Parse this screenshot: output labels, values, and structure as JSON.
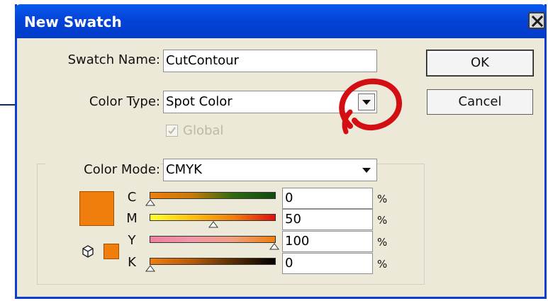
{
  "window": {
    "title": "New Swatch"
  },
  "swatch_name": {
    "label": "Swatch Name:",
    "value": "CutContour"
  },
  "color_type": {
    "label": "Color Type:",
    "value": "Spot Color"
  },
  "global": {
    "label": "Global",
    "checked": true,
    "enabled": false
  },
  "color_mode": {
    "label": "Color Mode:",
    "value": "CMYK"
  },
  "buttons": {
    "ok": "OK",
    "cancel": "Cancel"
  },
  "channels": [
    {
      "label": "C",
      "value": "0",
      "percent": 0,
      "unit": "%"
    },
    {
      "label": "M",
      "value": "50",
      "percent": 50,
      "unit": "%"
    },
    {
      "label": "Y",
      "value": "100",
      "percent": 100,
      "unit": "%"
    },
    {
      "label": "K",
      "value": "0",
      "percent": 0,
      "unit": "%"
    }
  ],
  "colors": {
    "swatch": "#f07e0d",
    "title_bar": "#0443d8",
    "dialog_bg": "#ece9d8",
    "highlight_circle": "#d40f14",
    "callout_line": "#0b2a6b"
  },
  "icons": {
    "close": "close-x-icon",
    "dropdown": "chevron-down-icon",
    "out_of_gamut": "cube-icon",
    "slider_thumb": "triangle-up-icon"
  }
}
